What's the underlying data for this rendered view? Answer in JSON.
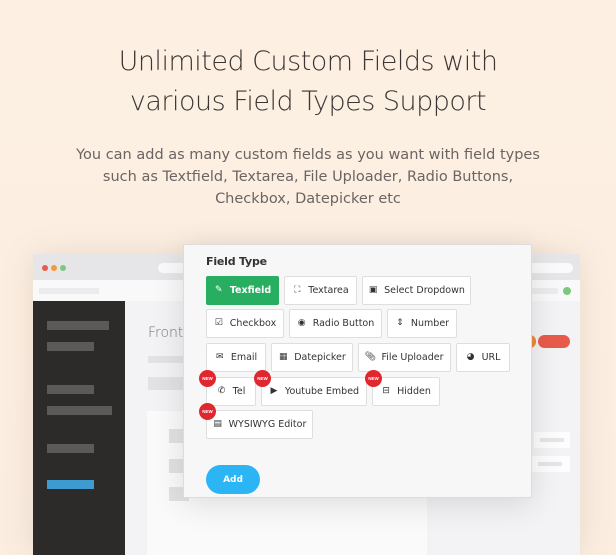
{
  "hero": {
    "title_line1": "Unlimited Custom Fields with",
    "title_line2": "various Field Types Support",
    "description": "You can add as many custom fields as you want with field types such as Textfield, Textarea, File Uploader, Radio Buttons, Checkbox, Datepicker etc"
  },
  "mock_browser": {
    "window_dots": [
      "#e85b4b",
      "#f09a3c",
      "#7cc87f"
    ],
    "content_label": "Fronte",
    "accent_colors": {
      "sidebar_active": "#3d9bd1",
      "status_green": "#7cc87f",
      "pill_red": "#e85b4b"
    }
  },
  "field_panel": {
    "title": "Field Type",
    "buttons": [
      {
        "label": "Texfield",
        "icon": "edit-icon",
        "active": true,
        "is_new": false
      },
      {
        "label": "Textarea",
        "icon": "expand-icon",
        "active": false,
        "is_new": false
      },
      {
        "label": "Select Dropdown",
        "icon": "caret-square-down-icon",
        "active": false,
        "is_new": false
      },
      {
        "label": "Checkbox",
        "icon": "check-square-icon",
        "active": false,
        "is_new": false
      },
      {
        "label": "Radio Button",
        "icon": "dot-circle-icon",
        "active": false,
        "is_new": false
      },
      {
        "label": "Number",
        "icon": "sort-icon",
        "active": false,
        "is_new": false
      },
      {
        "label": "Email",
        "icon": "envelope-icon",
        "active": false,
        "is_new": false
      },
      {
        "label": "Datepicker",
        "icon": "calendar-icon",
        "active": false,
        "is_new": false
      },
      {
        "label": "File Uploader",
        "icon": "paperclip-icon",
        "active": false,
        "is_new": false
      },
      {
        "label": "URL",
        "icon": "globe-icon",
        "active": false,
        "is_new": false
      },
      {
        "label": "Tel",
        "icon": "phone-icon",
        "active": false,
        "is_new": true
      },
      {
        "label": "Youtube Embed",
        "icon": "youtube-icon",
        "active": false,
        "is_new": true
      },
      {
        "label": "Hidden",
        "icon": "minus-square-icon",
        "active": false,
        "is_new": true
      },
      {
        "label": "WYSIWYG Editor",
        "icon": "word-file-icon",
        "active": false,
        "is_new": true
      }
    ],
    "new_badge_label": "NEW",
    "add_label": "Add",
    "colors": {
      "active": "#27ae60",
      "add": "#2cb5f5",
      "new_badge": "#e0262e"
    }
  }
}
